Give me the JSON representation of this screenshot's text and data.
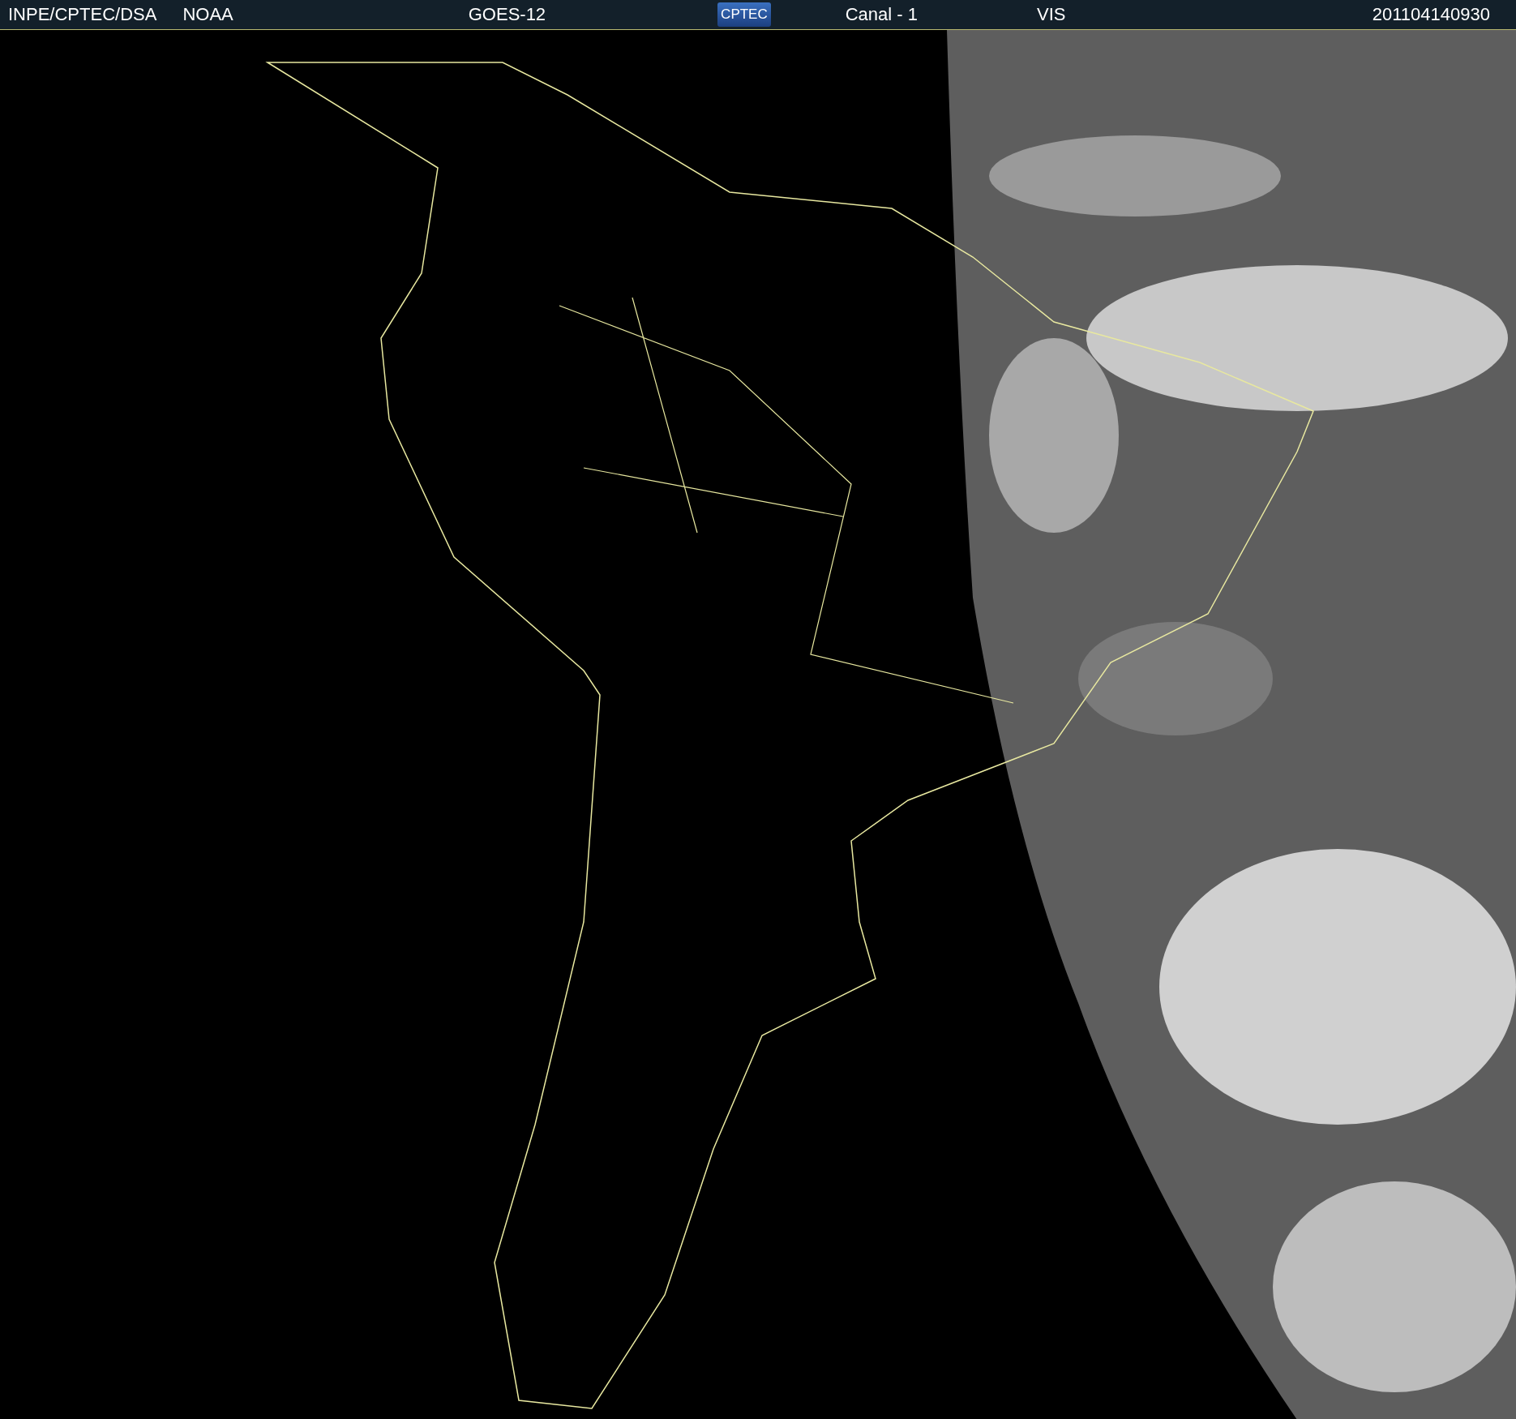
{
  "header": {
    "items": [
      {
        "kind": "text",
        "text": "INPE/CPTEC/DSA"
      },
      {
        "kind": "text",
        "text": "NOAA"
      },
      {
        "kind": "text",
        "text": "GOES-12"
      },
      {
        "kind": "logo",
        "text": "CPTEC"
      },
      {
        "kind": "text",
        "text": "Canal - 1"
      },
      {
        "kind": "text",
        "text": "VIS"
      },
      {
        "kind": "text",
        "text": "201104140930"
      }
    ]
  }
}
